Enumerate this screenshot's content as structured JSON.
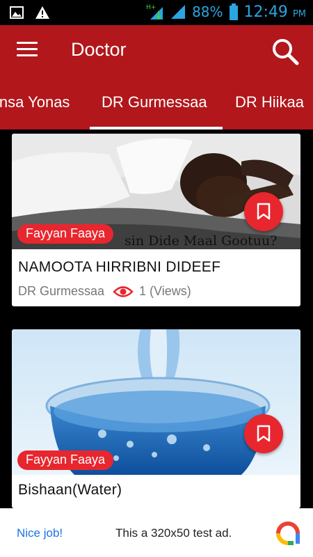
{
  "status_bar": {
    "icons": [
      "image-icon",
      "warning-icon",
      "network-hplus-icon",
      "signal-icon",
      "battery-icon"
    ],
    "battery": "88%",
    "time": "12:49",
    "ampm": "PM",
    "color": "#2aa5e0"
  },
  "app_bar": {
    "title": "Doctor",
    "background": "#b1171b"
  },
  "tabs": [
    {
      "label": "insa Yonas",
      "selected": false
    },
    {
      "label": "DR Gurmessaa",
      "selected": true
    },
    {
      "label": "DR Hiikaa",
      "selected": false
    }
  ],
  "cards": [
    {
      "category": "Fayyan Faaya",
      "image_caption": "sin Dide Maal Gootuu?",
      "title": "NAMOOTA HIRRIBNI DIDEEF",
      "author": "DR Gurmessaa",
      "views": "1 (Views)"
    },
    {
      "category": "Fayyan Faaya",
      "title": "Bishaan(Water)"
    }
  ],
  "ad": {
    "cta": "Nice job!",
    "text": "This a 320x50 test ad."
  },
  "accent_color": "#e8262e"
}
